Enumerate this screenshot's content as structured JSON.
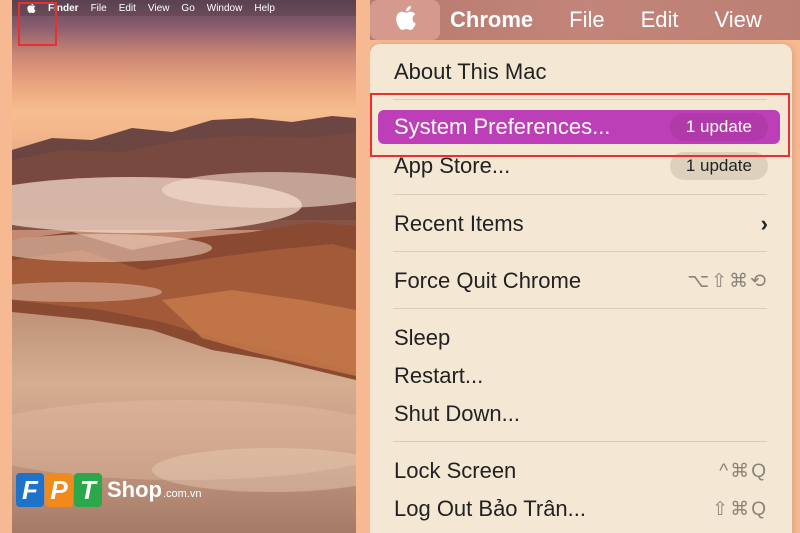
{
  "desktop": {
    "menubar": [
      "Finder",
      "File",
      "Edit",
      "View",
      "Go",
      "Window",
      "Help"
    ],
    "logo": {
      "letters": [
        "F",
        "P",
        "T"
      ],
      "shop": "Shop",
      "domain": ".com.vn"
    }
  },
  "menubar": {
    "app_name": "Chrome",
    "items": [
      "File",
      "Edit",
      "View"
    ]
  },
  "apple_menu": {
    "items": [
      {
        "label": "About This Mac"
      },
      {
        "label": "System Preferences...",
        "badge": "1 update",
        "selected": true
      },
      {
        "label": "App Store...",
        "badge": "1 update"
      },
      {
        "label": "Recent Items",
        "submenu": true
      },
      {
        "label": "Force Quit Chrome",
        "shortcut": "⌥⇧⌘⟲"
      },
      {
        "label": "Sleep"
      },
      {
        "label": "Restart..."
      },
      {
        "label": "Shut Down..."
      },
      {
        "label": "Lock Screen",
        "shortcut": "^⌘Q"
      },
      {
        "label": "Log Out Bảo Trân...",
        "shortcut": "⇧⌘Q"
      }
    ]
  },
  "colors": {
    "highlight": "#bd3fb8",
    "annotation": "#e8302e",
    "menu_bg": "#f4e8d5",
    "frame_bg": "#f7b992"
  }
}
